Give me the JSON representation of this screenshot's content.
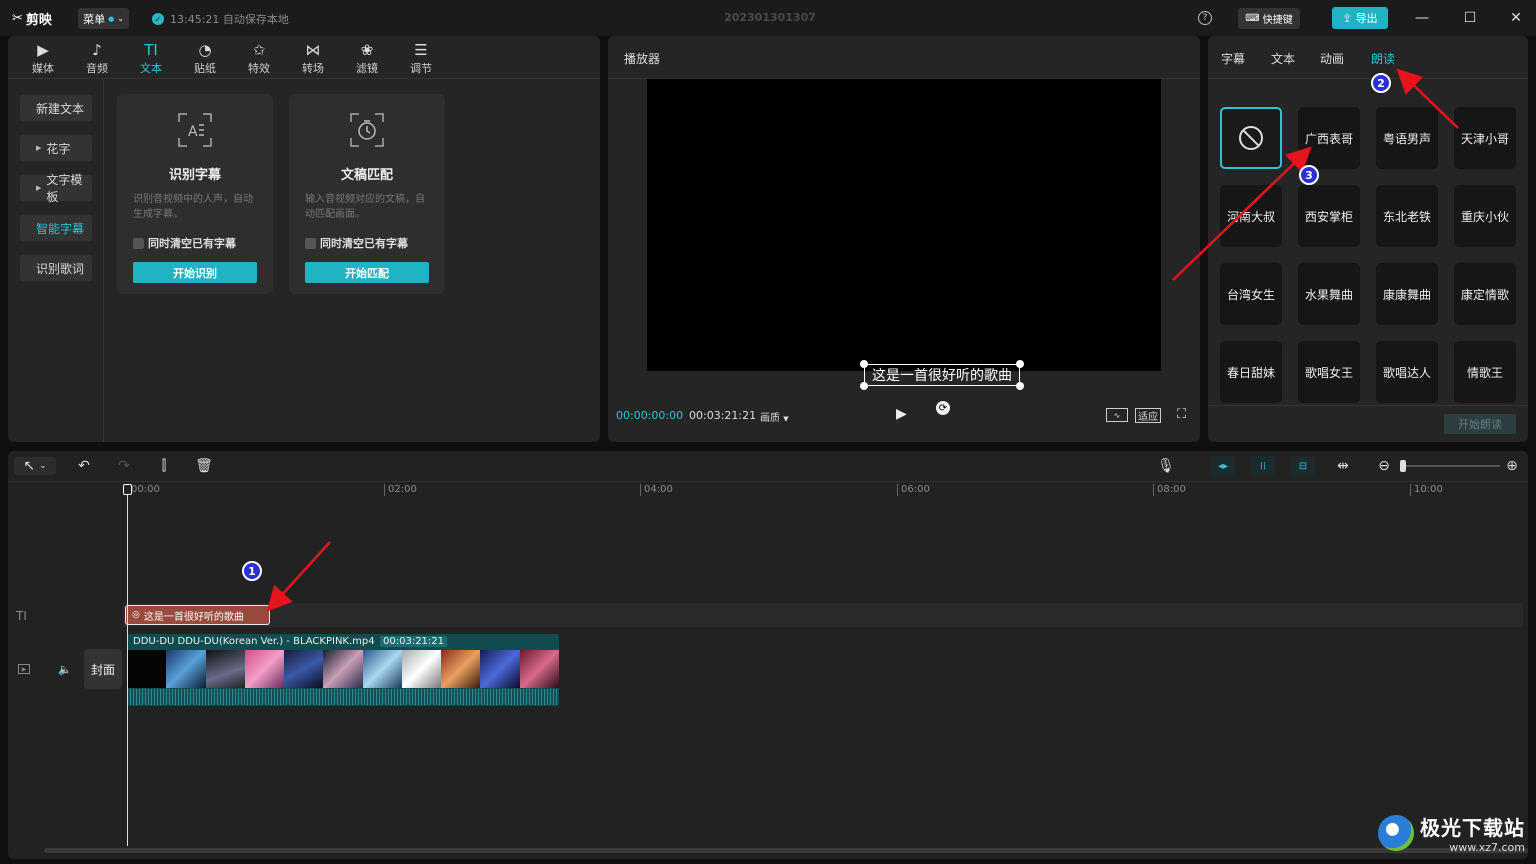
{
  "app": {
    "logo_text": "剪映",
    "menu_label": "菜单",
    "save_status": "13:45:21 自动保存本地",
    "project_title": "202301301307",
    "shortcut_label": "快捷键",
    "export_label": "导出"
  },
  "left_panel": {
    "tabs": [
      {
        "label": "媒体",
        "icon": "media-icon",
        "glyph": "▶"
      },
      {
        "label": "音频",
        "icon": "audio-icon",
        "glyph": "♪"
      },
      {
        "label": "文本",
        "icon": "text-icon",
        "glyph": "TI"
      },
      {
        "label": "贴纸",
        "icon": "sticker-icon",
        "glyph": "◔"
      },
      {
        "label": "特效",
        "icon": "effects-icon",
        "glyph": "✩"
      },
      {
        "label": "转场",
        "icon": "transition-icon",
        "glyph": "⋈"
      },
      {
        "label": "滤镜",
        "icon": "filter-icon",
        "glyph": "❀"
      },
      {
        "label": "调节",
        "icon": "adjust-icon",
        "glyph": "☰"
      }
    ],
    "active_tab": "文本",
    "sidebar": [
      "新建文本",
      "花字",
      "文字模板",
      "智能字幕",
      "识别歌词"
    ],
    "cards": [
      {
        "title": "识别字幕",
        "desc": "识别音视频中的人声，自动生成字幕。",
        "checkbox": "同时清空已有字幕",
        "button": "开始识别"
      },
      {
        "title": "文稿匹配",
        "desc": "输入音视频对应的文稿，自动匹配画面。",
        "checkbox": "同时清空已有字幕",
        "button": "开始匹配"
      }
    ]
  },
  "player": {
    "title": "播放器",
    "subtitle_text": "这是一首很好听的歌曲",
    "current_time": "00:00:00:00",
    "total_time": "00:03:21:21",
    "quality_label": "画质",
    "fit_label": "适应"
  },
  "right_panel": {
    "tabs": [
      "字幕",
      "文本",
      "动画",
      "朗读"
    ],
    "active_tab": "朗读",
    "voices": [
      "广西表哥",
      "粤语男声",
      "天津小哥",
      "河南大叔",
      "西安掌柜",
      "东北老铁",
      "重庆小伙",
      "台湾女生",
      "水果舞曲",
      "康康舞曲",
      "康定情歌",
      "春日甜妹",
      "歌唱女王",
      "歌唱达人",
      "情歌王"
    ],
    "read_button": "开始朗读"
  },
  "timeline": {
    "ruler_ticks": [
      "00:00",
      "02:00",
      "04:00",
      "06:00",
      "08:00",
      "10:00"
    ],
    "text_clip_label": "这是一首很好听的歌曲",
    "video_clip_name": "DDU-DU DDU-DU(Korean Ver.) - BLACKPINK.mp4",
    "video_clip_duration": "00:03:21:21",
    "cover_label": "封面",
    "zoom_level": 0.05
  },
  "annotations": {
    "badges": [
      "1",
      "2",
      "3"
    ],
    "arrow_color": "#e8141c",
    "badge_color": "#2a2fd8"
  },
  "watermark": {
    "name": "极光下载站",
    "url": "www.xz7.com"
  },
  "colors": {
    "accent": "#1fb3c4",
    "background": "#101010",
    "panel": "#252525"
  }
}
